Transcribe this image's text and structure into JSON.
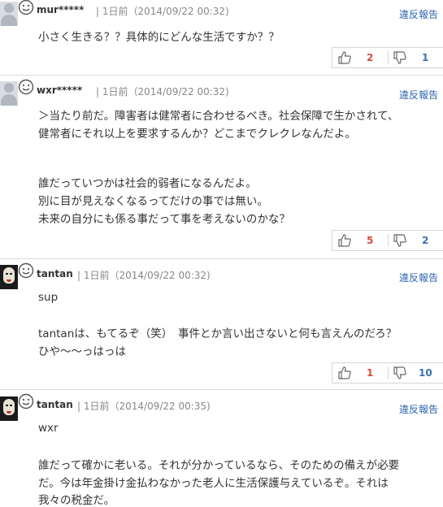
{
  "report_label": "違反報告",
  "comments": [
    {
      "username": "mur*****",
      "meta": "| 1日前（2014/09/22 00:32)",
      "lines": [
        "小さく生きる？？具体的にどんな生活ですか？？"
      ],
      "good_count": "2",
      "bad_count": "1"
    },
    {
      "username": "wxr*****",
      "meta": "| 1日前（2014/09/22 00:32)",
      "lines": [
        "＞当たり前だ。障害者は健常者に合わせるべき。社会保障で生かされて、",
        "健常者にそれ以上を要求するんか？どこまでクレクレなんだよ。",
        "誰だっていつかは社会的弱者になるんだよ。",
        "別に目が見えなくなるってだけの事では無い。",
        "未来の自分にも係る事だって事を考えないのかな？"
      ],
      "good_count": "5",
      "bad_count": "2"
    },
    {
      "username": "tantan",
      "meta": "| 1日前（2014/09/22 00:32)",
      "lines": [
        "sup",
        "tantanは、もてるぞ（笑）　事件とか言い出さないと何も言えんのだろ？",
        "ひや～～っはっは"
      ],
      "good_count": "1",
      "bad_count": "10"
    },
    {
      "username": "tantan",
      "meta": "| 1日前（2014/09/22 00:35)",
      "lines": [
        "wxr",
        "誰だって確かに老いる。それが分かっているなら、そのための備えが必要",
        "だ。今は年金掛け金払わなかった老人に生活保護与えているぞ。それは",
        "我々の税金だ。"
      ]
    }
  ]
}
